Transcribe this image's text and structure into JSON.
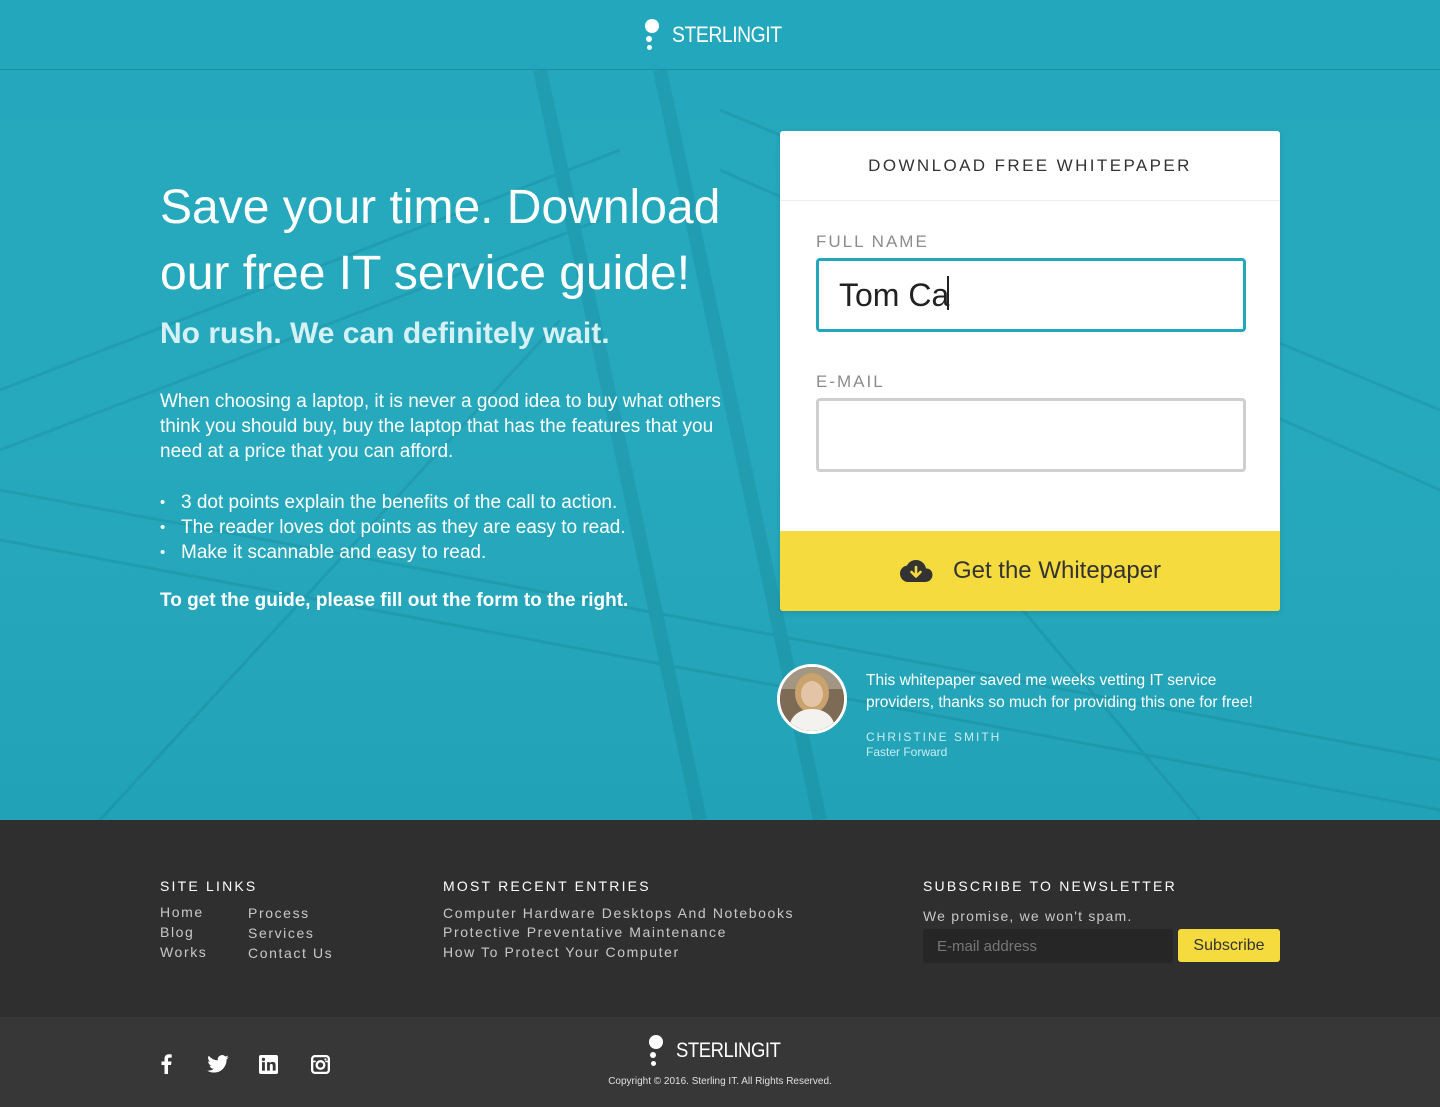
{
  "brand": {
    "name": "STERLINGIT"
  },
  "hero": {
    "title": "Save your time. Download our free IT service guide!",
    "subtitle": "No rush. We can definitely wait.",
    "body": "When choosing a laptop, it is never a good idea to buy what others think you should buy, buy the laptop that has the features that you need at a price that you can afford.",
    "bullets": [
      "3 dot points explain the benefits of the call to action.",
      "The reader loves dot points as they are easy to read.",
      "Make it scannable and easy to read."
    ],
    "cta": "To get the guide, please fill out the form to the right."
  },
  "form": {
    "heading": "DOWNLOAD FREE WHITEPAPER",
    "name_label": "FULL NAME",
    "name_value": "Tom Ca",
    "email_label": "E-MAIL",
    "email_value": "",
    "submit_label": "Get the Whitepaper"
  },
  "testimonial": {
    "quote": "This whitepaper saved me weeks vetting IT service providers, thanks so much for providing this one for free!",
    "author": "CHRISTINE SMITH",
    "company": "Faster Forward"
  },
  "footer": {
    "site_links_title": "SITE LINKS",
    "site_links_col1": [
      "Home",
      "Blog",
      "Works"
    ],
    "site_links_col2": [
      "Process",
      "Services",
      "Contact Us"
    ],
    "recent_title": "MOST RECENT ENTRIES",
    "recent_entries": [
      "Computer Hardware Desktops And Notebooks",
      "Protective Preventative Maintenance",
      "How To Protect Your Computer"
    ],
    "newsletter_title": "SUBSCRIBE TO NEWSLETTER",
    "newsletter_note": "We promise, we won't spam.",
    "newsletter_placeholder": "E-mail address",
    "newsletter_button": "Subscribe",
    "social_icons": [
      "facebook-icon",
      "twitter-icon",
      "linkedin-icon",
      "instagram-icon"
    ],
    "copyright": "Copyright © 2016.  Sterling IT.  All Rights Reserved."
  },
  "colors": {
    "teal": "#22a7bc",
    "yellow": "#f5db3d",
    "footer_dark": "#2f2f2f",
    "footer_bottom": "#373737"
  }
}
